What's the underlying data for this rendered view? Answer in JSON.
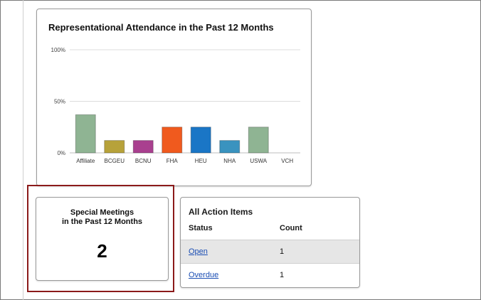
{
  "chart": {
    "title": "Representational Attendance in the Past 12 Months"
  },
  "chart_data": {
    "type": "bar",
    "title": "Representational Attendance in the Past 12 Months",
    "categories": [
      "Affiliate",
      "BCGEU",
      "BCNU",
      "FHA",
      "HEU",
      "NHA",
      "USWA",
      "VCH"
    ],
    "values": [
      37,
      12,
      12,
      25,
      25,
      12,
      25,
      0
    ],
    "colors": [
      "#8fb493",
      "#b7a23a",
      "#a9408f",
      "#f05a1e",
      "#1a76c6",
      "#3a93bf",
      "#8fb493",
      "#8fb493"
    ],
    "yticks": [
      "100%",
      "50%",
      "0%"
    ],
    "ylim": [
      0,
      100
    ],
    "grid": true
  },
  "meetings": {
    "title_line1": "Special Meetings",
    "title_line2": "in the Past 12 Months",
    "count": "2"
  },
  "actions": {
    "title": "All Action Items",
    "col_status": "Status",
    "col_count": "Count",
    "rows": [
      {
        "status": "Open",
        "count": "1"
      },
      {
        "status": "Overdue",
        "count": "1"
      }
    ]
  }
}
